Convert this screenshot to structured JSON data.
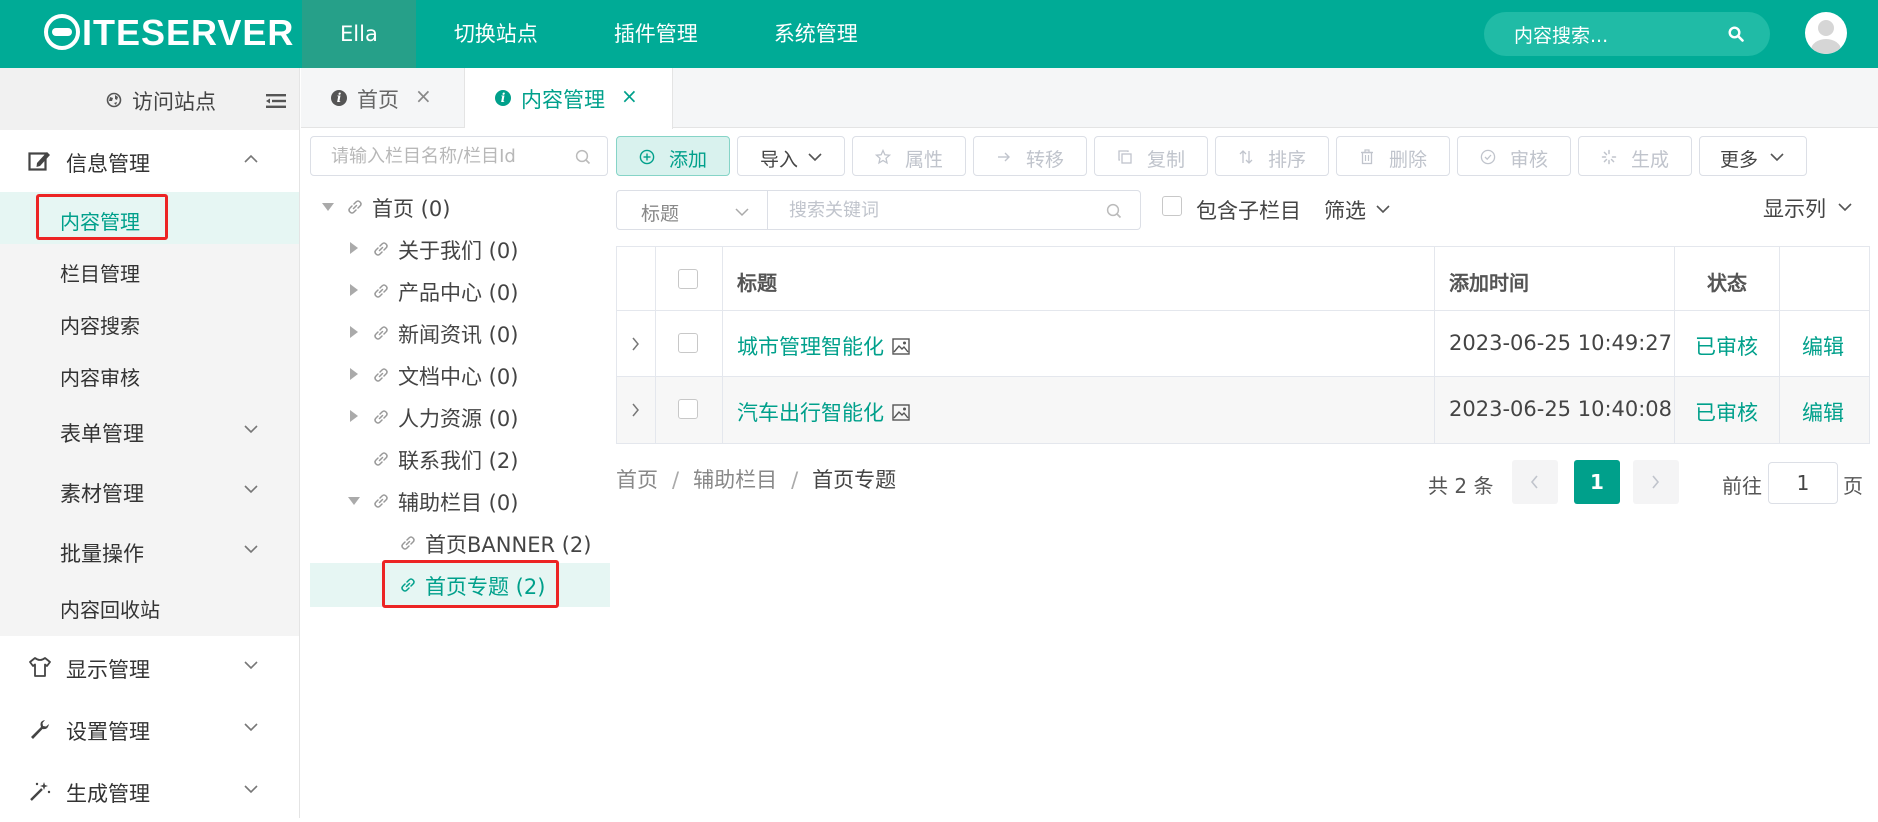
{
  "header": {
    "logo": "ITESERVER",
    "nav": [
      {
        "label": "Ella",
        "active": true
      },
      {
        "label": "切换站点"
      },
      {
        "label": "插件管理"
      },
      {
        "label": "系统管理"
      }
    ],
    "search_placeholder": "内容搜索...",
    "accent": "#00ab96"
  },
  "sidebar": {
    "visit_site": "访问站点",
    "info_group": "信息管理",
    "items": [
      {
        "label": "内容管理",
        "active": true
      },
      {
        "label": "栏目管理"
      },
      {
        "label": "内容搜索"
      },
      {
        "label": "内容审核"
      }
    ],
    "sub_groups": [
      {
        "label": "表单管理"
      },
      {
        "label": "素材管理"
      },
      {
        "label": "批量操作"
      }
    ],
    "recycle": "内容回收站",
    "groups": [
      {
        "label": "显示管理",
        "icon": "shirt-icon"
      },
      {
        "label": "设置管理",
        "icon": "wrench-icon"
      },
      {
        "label": "生成管理",
        "icon": "magic-wand-icon"
      }
    ]
  },
  "tabs": [
    {
      "label": "首页",
      "close": "×"
    },
    {
      "label": "内容管理",
      "close": "×",
      "active": true
    }
  ],
  "tree": {
    "search_placeholder": "请输入栏目名称/栏目Id",
    "nodes": [
      {
        "label": "首页 (0)"
      },
      {
        "label": "关于我们 (0)"
      },
      {
        "label": "产品中心 (0)"
      },
      {
        "label": "新闻资讯 (0)"
      },
      {
        "label": "文档中心 (0)"
      },
      {
        "label": "人力资源 (0)"
      },
      {
        "label": "联系我们 (2)"
      },
      {
        "label": "辅助栏目 (0)"
      },
      {
        "label": "首页BANNER (2)"
      },
      {
        "label": "首页专题 (2)",
        "active": true
      }
    ]
  },
  "toolbar": {
    "add": "添加",
    "import": "导入",
    "attribute": "属性",
    "move": "转移",
    "copy": "复制",
    "sort": "排序",
    "delete": "删除",
    "audit": "审核",
    "generate": "生成",
    "more": "更多"
  },
  "filter": {
    "field": "标题",
    "keyword_placeholder": "搜索关键词",
    "include_children": "包含子栏目",
    "filter": "筛选",
    "show_columns": "显示列"
  },
  "table": {
    "headers": {
      "title": "标题",
      "time": "添加时间",
      "status": "状态"
    },
    "rows": [
      {
        "title": "城市管理智能化",
        "time": "2023-06-25 10:49:27",
        "status": "已审核",
        "op": "编辑"
      },
      {
        "title": "汽车出行智能化",
        "time": "2023-06-25 10:40:08",
        "status": "已审核",
        "op": "编辑"
      }
    ]
  },
  "breadcrumb": [
    "首页",
    "辅助栏目",
    "首页专题"
  ],
  "breadcrumb_sep": "/",
  "pager": {
    "total": "共 2 条",
    "current": "1",
    "goto": "前往",
    "goto_value": "1",
    "page_unit": "页"
  }
}
